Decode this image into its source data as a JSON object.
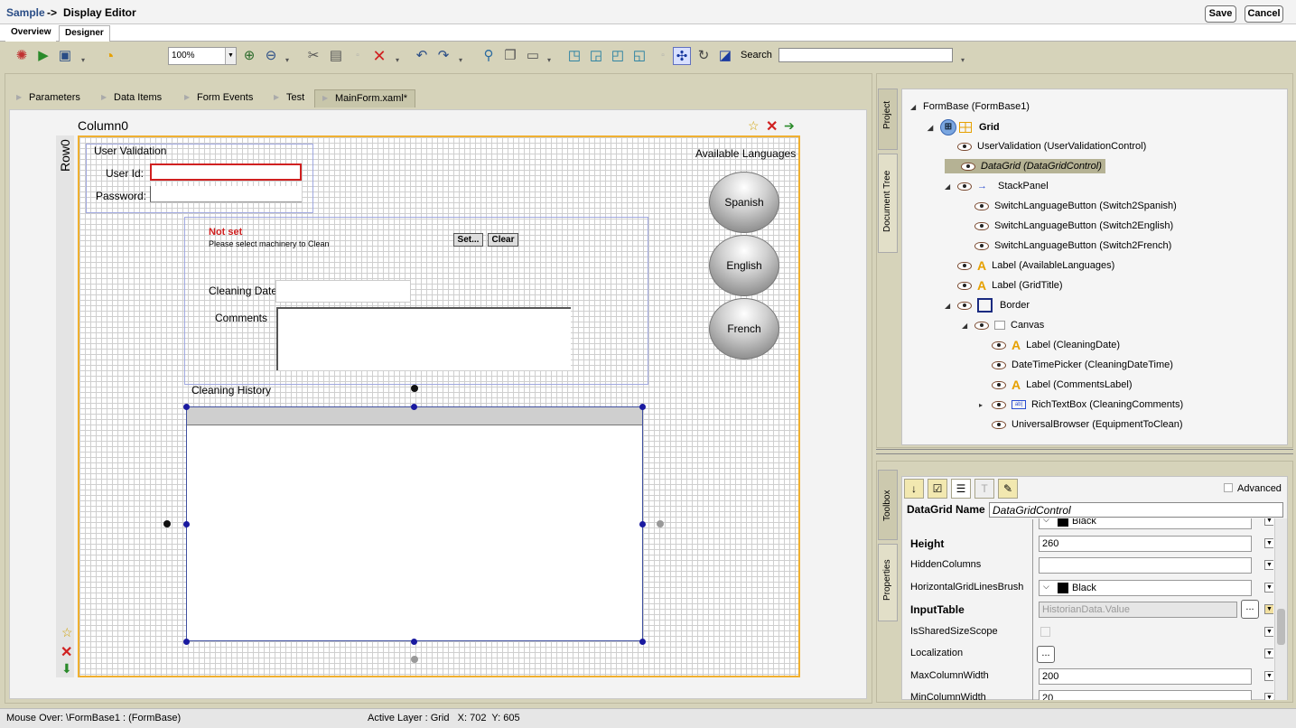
{
  "titlebar": {
    "breadcrumb": "Sample",
    "arrow": "->",
    "title": "Display Editor",
    "save": "Save",
    "cancel": "Cancel"
  },
  "view_tabs": [
    "Overview",
    "Designer"
  ],
  "toolbar": {
    "zoom": "100%",
    "search_label": "Search",
    "search_value": ""
  },
  "doc_tabs": [
    "Parameters",
    "Data Items",
    "Form Events",
    "Test",
    "MainForm.xaml*"
  ],
  "designer": {
    "column_header": "Column0",
    "row_header": "Row0",
    "user_validation": "User Validation",
    "user_id": "User Id:",
    "password": "Password:",
    "not_set": "Not set",
    "please_select": "Please select machinery to Clean",
    "set_btn": "Set...",
    "clear_btn": "Clear",
    "cleaning_date": "Cleaning Date",
    "comments": "Comments",
    "cleaning_history": "Cleaning History",
    "available_languages": "Available Languages",
    "languages": [
      "Spanish",
      "English",
      "French"
    ]
  },
  "side_tabs": {
    "project": "Project",
    "document_tree": "Document Tree",
    "toolbox": "Toolbox",
    "properties": "Properties"
  },
  "tree": [
    {
      "text": "FormBase (FormBase1)",
      "indent": 0,
      "exp": "◢",
      "icon": "none"
    },
    {
      "text": "Grid",
      "indent": 1,
      "exp": "◢",
      "icon": "grid",
      "bold": true
    },
    {
      "text": "UserValidation (UserValidationControl)",
      "indent": 2,
      "exp": "",
      "icon": "eye"
    },
    {
      "text": "DataGrid (DataGridControl)",
      "indent": 2,
      "exp": "",
      "icon": "eye",
      "selected": true
    },
    {
      "text": "StackPanel",
      "indent": 2,
      "exp": "◢",
      "icon": "eye-arrow"
    },
    {
      "text": "SwitchLanguageButton (Switch2Spanish)",
      "indent": 3,
      "exp": "",
      "icon": "eye"
    },
    {
      "text": "SwitchLanguageButton (Switch2English)",
      "indent": 3,
      "exp": "",
      "icon": "eye"
    },
    {
      "text": "SwitchLanguageButton (Switch2French)",
      "indent": 3,
      "exp": "",
      "icon": "eye"
    },
    {
      "text": "Label (AvailableLanguages)",
      "indent": 2,
      "exp": "",
      "icon": "eye-a"
    },
    {
      "text": "Label (GridTitle)",
      "indent": 2,
      "exp": "",
      "icon": "eye-a"
    },
    {
      "text": "Border",
      "indent": 2,
      "exp": "◢",
      "icon": "eye-border"
    },
    {
      "text": "Canvas",
      "indent": 3,
      "exp": "◢",
      "icon": "eye-canvas"
    },
    {
      "text": "Label (CleaningDate)",
      "indent": 4,
      "exp": "",
      "icon": "eye-a"
    },
    {
      "text": "DateTimePicker (CleaningDateTime)",
      "indent": 4,
      "exp": "",
      "icon": "eye"
    },
    {
      "text": "Label (CommentsLabel)",
      "indent": 4,
      "exp": "",
      "icon": "eye-a"
    },
    {
      "text": "RichTextBox (CleaningComments)",
      "indent": 4,
      "exp": "▸",
      "icon": "eye-rtb"
    },
    {
      "text": "UniversalBrowser (EquipmentToClean)",
      "indent": 4,
      "exp": "",
      "icon": "eye"
    }
  ],
  "properties": {
    "advanced": "Advanced",
    "name_label": "DataGrid Name",
    "name_value": "DataGridControl",
    "rows": [
      {
        "name": "",
        "value": "Black",
        "bold": false,
        "swatch": true,
        "partial": true
      },
      {
        "name": "Height",
        "value": "260",
        "bold": true
      },
      {
        "name": "HiddenColumns",
        "value": "",
        "bold": false
      },
      {
        "name": "HorizontalGridLinesBrush",
        "value": "Black",
        "bold": false,
        "swatch": true
      },
      {
        "name": "InputTable",
        "value": "HistorianData.Value",
        "bold": true,
        "disabled": true,
        "ellipsis": true
      },
      {
        "name": "IsSharedSizeScope",
        "value": "",
        "bold": false,
        "checkbox": true
      },
      {
        "name": "Localization",
        "value": "",
        "bold": false,
        "ellipsis_only": true
      },
      {
        "name": "MaxColumnWidth",
        "value": "200",
        "bold": false
      },
      {
        "name": "MinColumnWidth",
        "value": "20",
        "bold": false
      }
    ]
  },
  "status": {
    "mouse_over": "Mouse Over: \\FormBase1 : (FormBase)",
    "active_layer": "Active Layer : Grid   X: 702  Y: 605"
  }
}
